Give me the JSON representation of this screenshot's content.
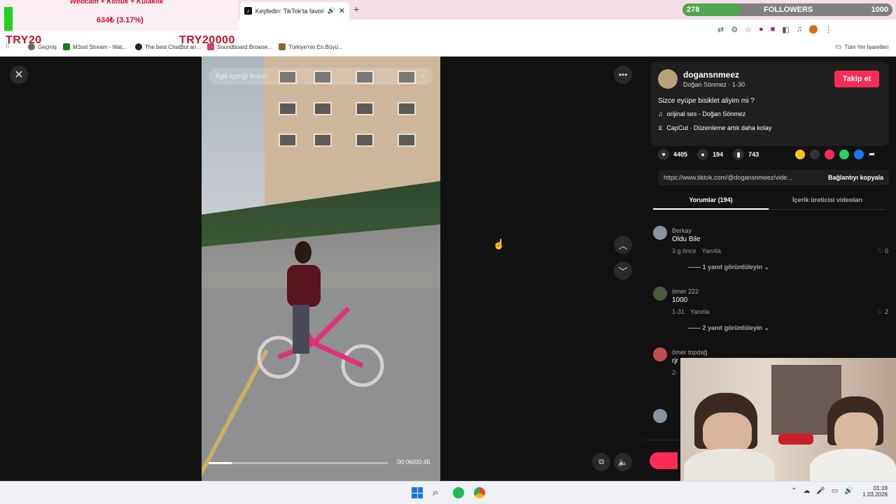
{
  "browser": {
    "active_tab_title": "Keşfedin: TikTok'ta favori vi",
    "new_tab_symbol": "+",
    "bookmarks": [
      {
        "label": "Geçmiş",
        "color": "#666666"
      },
      {
        "label": "M3sst Stream - Wat...",
        "color": "#1f7a1f"
      },
      {
        "label": "The best ChatBot an...",
        "color": "#222222"
      },
      {
        "label": "Soundboard Browse...",
        "color": "#d0407a"
      },
      {
        "label": "Türkiye'nin En Büyü...",
        "color": "#333333"
      }
    ],
    "all_bookmarks_label": "Tüm Yer İşaretleri"
  },
  "stream_overlay": {
    "goal_text": "Webcam + Koltuk + Kulaklık",
    "goal_progress": "634₺ (3.17%)",
    "goal_percent": 3.17,
    "try_left": "TRY20",
    "try_right": "TRY20000",
    "followers_label": "FOLLOWERS",
    "followers_current": "278",
    "followers_goal": "1000"
  },
  "video": {
    "search_placeholder": "İlgili içeriği bulun",
    "timecode": "00:06/00:45",
    "progress": 0.13
  },
  "post": {
    "username": "dogansnmeez",
    "display_name": "Doğan Sönmez · 1-30",
    "follow_label": "Takip et",
    "caption": "Sizce eyüpe bisiklet aliyim mi ?",
    "sound": "orijinal ses - Doğan Sönmez",
    "capcut": "CapCut · Düzenleme artık daha kolay",
    "likes": "4405",
    "comments": "194",
    "saves": "743",
    "link": "https://www.tiktok.com/@dogansnmeez/vide...",
    "copy_link_label": "Bağlantıyı kopyala",
    "tab_comments": "Yorumlar (194)",
    "tab_creator": "İçerik üreticisi videoları"
  },
  "comments": [
    {
      "user": "Berkay",
      "text": "Oldu Bile",
      "time": "3 g önce",
      "reply": "Yanıtla",
      "likes": "0",
      "replies": "1 yanıt görüntüleyin"
    },
    {
      "user": "ömer 222",
      "text": "1000",
      "time": "1-31",
      "reply": "Yanıtla",
      "likes": "2",
      "replies": "2 yanıt görüntüleyin"
    },
    {
      "user": "ömer topdağ",
      "text": "rjr",
      "time": "2-",
      "reply": "",
      "likes": "",
      "replies": ""
    }
  ],
  "taskbar": {
    "time": "01:19",
    "date": "1.03.2026"
  }
}
